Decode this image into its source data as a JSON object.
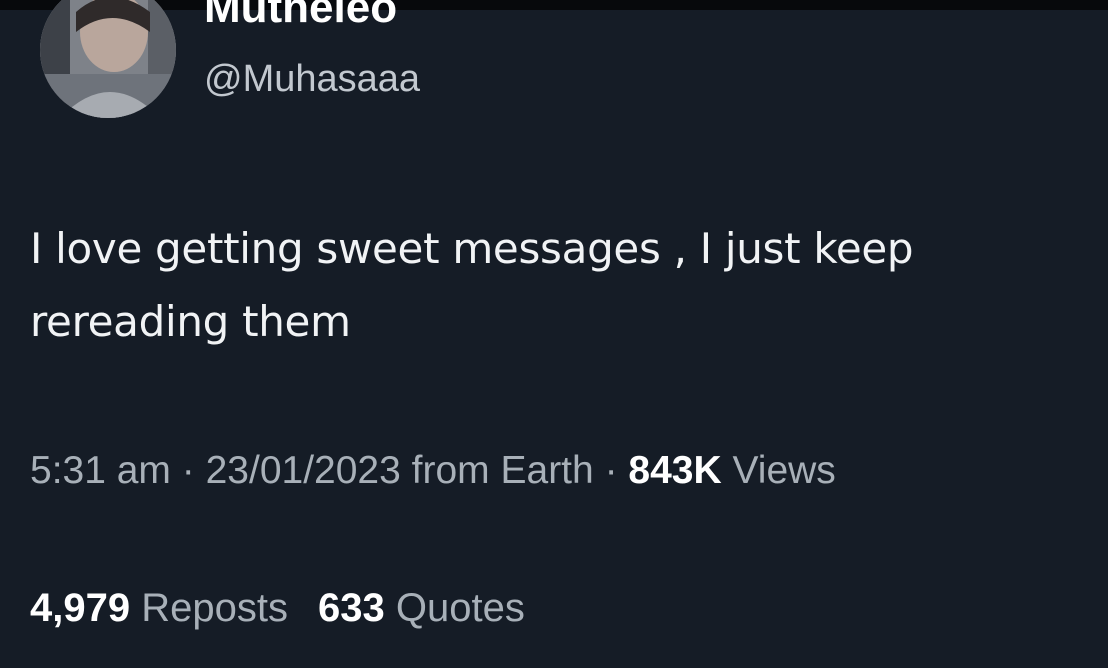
{
  "tweet": {
    "author": {
      "display_name": "Mutheleo",
      "handle": "@Muhasaaa"
    },
    "text_line1": "I love getting sweet messages , I just keep",
    "text_line2": "rereading them",
    "meta": {
      "time": "5:31 am",
      "separator": "·",
      "date": "23/01/2023",
      "source": "from Earth",
      "views_count": "843K",
      "views_label": "Views"
    },
    "stats": {
      "reposts_count": "4,979",
      "reposts_label": "Reposts",
      "quotes_count": "633",
      "quotes_label": "Quotes"
    }
  },
  "colors": {
    "background": "#151c26",
    "primary_text": "#f1f3f5",
    "secondary_text": "#a8b0b8"
  }
}
